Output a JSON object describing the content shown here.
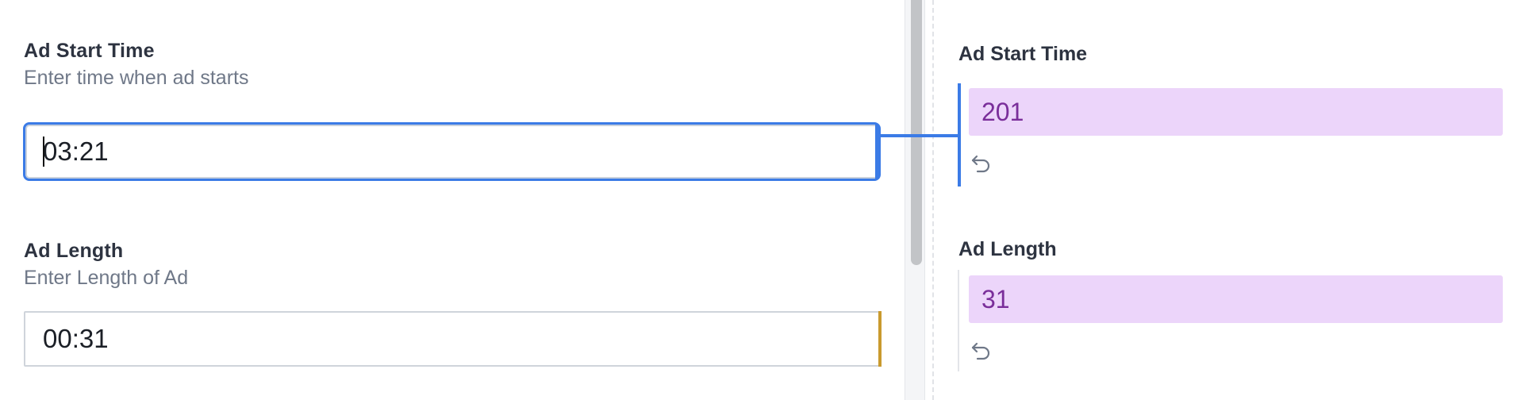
{
  "editor": {
    "fields": [
      {
        "title": "Ad Start Time",
        "description": "Enter time when ad starts",
        "value": "03:21"
      },
      {
        "title": "Ad Length",
        "description": "Enter Length of Ad",
        "value": "00:31"
      }
    ]
  },
  "preview": {
    "fields": [
      {
        "title": "Ad Start Time",
        "value": "201",
        "icon": "undo-icon"
      },
      {
        "title": "Ad Length",
        "value": "31",
        "icon": "undo-icon"
      }
    ]
  },
  "colors": {
    "focus_accent": "#3b7be6",
    "changed_marker": "#c99a2e",
    "preview_bg": "#ecd5fa",
    "preview_text": "#7a2e9a"
  }
}
